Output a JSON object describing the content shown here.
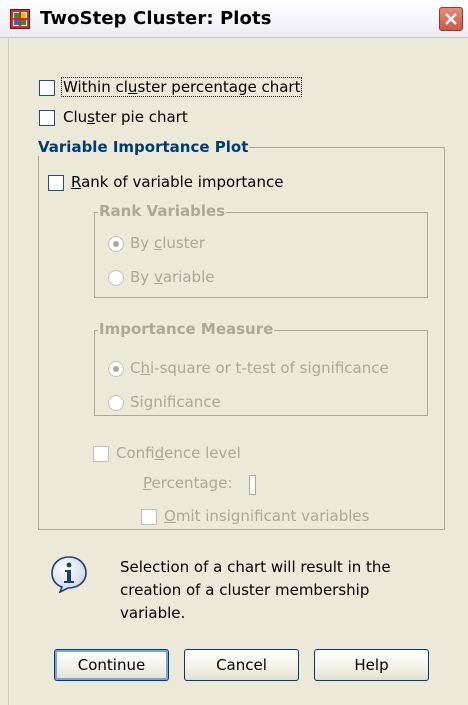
{
  "window": {
    "title": "TwoStep Cluster: Plots"
  },
  "checkboxes": {
    "within_cluster_pre": "Within cl",
    "within_cluster_u": "u",
    "within_cluster_post": "ster percentage chart",
    "pie_pre": "Clu",
    "pie_u": "s",
    "pie_post": "ter pie chart"
  },
  "var_importance": {
    "legend": "Variable Importance Plot",
    "rank_u": "R",
    "rank_post": "ank of variable importance",
    "rank_vars": {
      "legend": "Rank Variables",
      "by_cluster_pre": "By ",
      "by_cluster_u": "c",
      "by_cluster_post": "luster",
      "by_variable_pre": "By ",
      "by_variable_u": "v",
      "by_variable_post": "ariable"
    },
    "importance": {
      "legend": "Importance Measure",
      "chi_pre": "C",
      "chi_u": "h",
      "chi_post": "i-square or t-test of significance",
      "sig_pre": "Si",
      "sig_u": "g",
      "sig_post": "nificance"
    },
    "confidence": {
      "label_pre": "Confi",
      "label_u": "d",
      "label_post": "ence level",
      "pct_u": "P",
      "pct_post": "ercentage:",
      "omit_u": "O",
      "omit_post": "mit insignificant variables"
    }
  },
  "info": {
    "text": "Selection of a chart will result in the creation of a cluster membership variable."
  },
  "buttons": {
    "continue": "Continue",
    "cancel": "Cancel",
    "help": "Help"
  }
}
